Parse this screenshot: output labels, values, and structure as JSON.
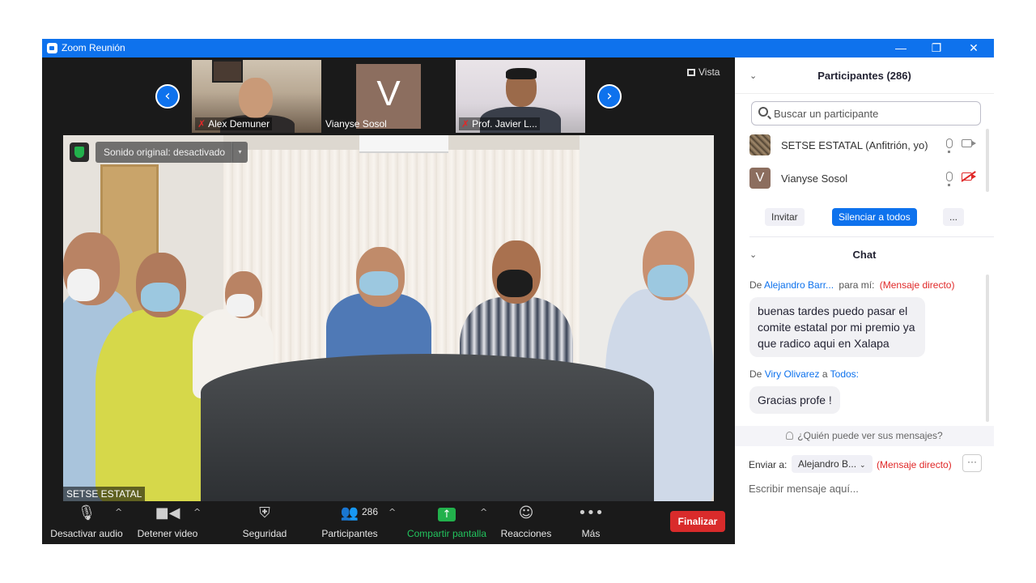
{
  "window": {
    "title": "Zoom Reunión",
    "minimize_glyph": "—",
    "restore_glyph": "❐",
    "close_glyph": "✕"
  },
  "gallery": {
    "prev_glyph": "‹",
    "next_glyph": "›",
    "view_label": "Vista",
    "thumbnails": [
      {
        "name": "Alex Demuner",
        "muted": true
      },
      {
        "name": "Vianyse Sosol",
        "initial": "V",
        "muted": false
      },
      {
        "name": "Prof. Javier L...",
        "muted": true
      }
    ]
  },
  "main_video": {
    "speaker_name": "SETSE ESTATAL",
    "sound_toggle": "Sonido original: desactivado",
    "sound_caret": "▾"
  },
  "toolbar": {
    "audio_label": "Desactivar audio",
    "video_label": "Detener video",
    "security_label": "Seguridad",
    "participants_label": "Participantes",
    "participants_count": "286",
    "share_label": "Compartir pantalla",
    "share_glyph": "↑",
    "reactions_label": "Reacciones",
    "more_label": "Más",
    "more_glyph": "•••",
    "caret": "^",
    "end_label": "Finalizar"
  },
  "participants_panel": {
    "title": "Participantes (286)",
    "collapse_glyph": "⌄",
    "search_placeholder": "Buscar un participante",
    "rows": [
      {
        "name": "SETSE ESTATAL (Anfitrión, yo)",
        "avatar": "photo"
      },
      {
        "name": "Vianyse Sosol",
        "initial": "V",
        "video_off": true
      }
    ],
    "invite_label": "Invitar",
    "mute_all_label": "Silenciar a todos",
    "more_label": "..."
  },
  "chat": {
    "title": "Chat",
    "collapse_glyph": "⌄",
    "messages": [
      {
        "from_prefix": "De",
        "sender": "Alejandro Barr...",
        "to_text": "para mí:",
        "tag": "(Mensaje directo)",
        "text": "buenas tardes puedo pasar el comite estatal por mi premio ya que radico aqui en Xalapa"
      },
      {
        "from_prefix": "De",
        "sender": "Viry Olivarez",
        "to_text": "a",
        "recipient": "Todos:",
        "text": "Gracias profe !"
      }
    ],
    "who_sees": "¿Quién puede ver sus mensajes?",
    "send_to_label": "Enviar a:",
    "recipient": "Alejandro B...",
    "recipient_caret": "⌄",
    "direct_tag": "(Mensaje directo)",
    "more_label": "···",
    "input_placeholder": "Escribir mensaje aquí..."
  },
  "colors": {
    "accent": "#0e72ed",
    "end_red": "#d92b2b",
    "share_green": "#22b14c",
    "direct_red": "#e02828"
  }
}
